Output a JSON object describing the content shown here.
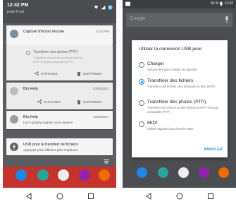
{
  "left_screen": {
    "time": "12:42 PM",
    "date": "jeudi 4 mai",
    "notifications": [
      {
        "title": "Capture d'écran réussie",
        "time": "12:42 PM"
      },
      {
        "option_label": "Transférer des photos (PTP)",
        "desc_line1": "Transférer des photos ou des fichiers si",
        "desc_line2": "MTP n'est pas compatible (PTP)",
        "share_label": "PARTAGER",
        "delete_label": "SUPPRIMER"
      },
      {
        "title": "Blu Help",
        "time": "03/05/2017",
        "share_label": "PARTAGER",
        "delete_label": "SUPPRIMER"
      },
      {
        "title": "Blu Help",
        "time": "03/05/2017",
        "subtitle": "Let's quickly register your device!"
      },
      {
        "title": "USB pour le transfert de fichiers",
        "subtitle": "Appuyez pour afficher plus d'options"
      }
    ]
  },
  "right_screen": {
    "battery": "54 %",
    "time": "12:42",
    "search_placeholder": "Google",
    "dialog": {
      "title": "Utiliser la connexion USB pour",
      "options": [
        {
          "label": "Charger",
          "desc": "Uniquement pour charger cet appareil",
          "selected": false
        },
        {
          "label": "Transférer des fichiers",
          "desc": "Transférer des fichiers vers Windows ou Mac (MTP)",
          "selected": true
        },
        {
          "label": "Transférer des photos (PTP)",
          "desc": "Transférer des photos ou des fichiers si MTP n'est pas compatible (PTP)",
          "selected": false
        },
        {
          "label": "MIDI",
          "desc": "Utiliser l'appareil pour l'entrée MIDI",
          "selected": false
        }
      ],
      "cancel_label": "ANNULER"
    }
  },
  "colors": {
    "accent_blue": "#1e88e5",
    "dock_red": "#c4332d"
  }
}
